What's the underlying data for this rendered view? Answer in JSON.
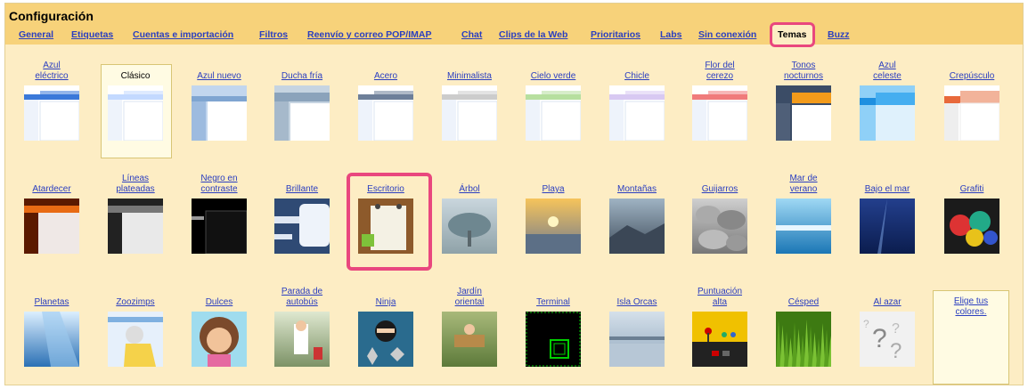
{
  "title": "Configuración",
  "tabs": [
    {
      "label": "General"
    },
    {
      "label": "Etiquetas"
    },
    {
      "label": "Cuentas e importación"
    },
    {
      "label": "Filtros"
    },
    {
      "label": "Reenvío y correo POP/IMAP"
    },
    {
      "label": "Chat"
    },
    {
      "label": "Clips de la Web"
    },
    {
      "label": "Prioritarios"
    },
    {
      "label": "Labs"
    },
    {
      "label": "Sin conexión"
    },
    {
      "label": "Temas",
      "active": true
    },
    {
      "label": "Buzz"
    }
  ],
  "themes": [
    {
      "row": 0,
      "col": 0,
      "label": "Azul\neléctrico",
      "icon": "azul-electrico-icon",
      "accent": "#3b79d9"
    },
    {
      "row": 0,
      "col": 1,
      "label": "Clásico",
      "icon": "clasico-icon",
      "accent": "#c3d9ff",
      "selected": true
    },
    {
      "row": 0,
      "col": 2,
      "label": "Azul nuevo",
      "icon": "azul-nuevo-icon",
      "accent": "#7fa5d1"
    },
    {
      "row": 0,
      "col": 3,
      "label": "Ducha fría",
      "icon": "ducha-fria-icon",
      "accent": "#8ba3bb"
    },
    {
      "row": 0,
      "col": 4,
      "label": "Acero",
      "icon": "acero-icon",
      "accent": "#6d7f99"
    },
    {
      "row": 0,
      "col": 5,
      "label": "Minimalista",
      "icon": "minimalista-icon",
      "accent": "#cccccc"
    },
    {
      "row": 0,
      "col": 6,
      "label": "Cielo verde",
      "icon": "cielo-verde-icon",
      "accent": "#b7df9f"
    },
    {
      "row": 0,
      "col": 7,
      "label": "Chicle",
      "icon": "chicle-icon",
      "accent": "#d8c9f2"
    },
    {
      "row": 0,
      "col": 8,
      "label": "Flor del\ncerezo",
      "icon": "flor-cerezo-icon",
      "accent": "#f07b7b"
    },
    {
      "row": 0,
      "col": 9,
      "label": "Tonos\nnocturnos",
      "icon": "tonos-nocturnos-icon",
      "accent": "#f39b1b"
    },
    {
      "row": 0,
      "col": 10,
      "label": "Azul\nceleste",
      "icon": "azul-celeste-icon",
      "accent": "#3aa3ec"
    },
    {
      "row": 0,
      "col": 11,
      "label": "Crepúsculo",
      "icon": "crepusculo-icon",
      "accent": "#e8693b"
    },
    {
      "row": 1,
      "col": 0,
      "label": "Atardecer",
      "icon": "atardecer-icon",
      "accent": "#e86b14"
    },
    {
      "row": 1,
      "col": 1,
      "label": "Líneas\nplateadas",
      "icon": "lineas-plateadas-icon",
      "accent": "#555555"
    },
    {
      "row": 1,
      "col": 2,
      "label": "Negro en\ncontraste",
      "icon": "negro-contraste-icon",
      "accent": "#222222"
    },
    {
      "row": 1,
      "col": 3,
      "label": "Brillante",
      "icon": "brillante-icon",
      "accent": "#4c6ea0"
    },
    {
      "row": 1,
      "col": 4,
      "label": "Escritorio",
      "icon": "escritorio-icon",
      "accent": "#8d5a2b",
      "highlighted": true
    },
    {
      "row": 1,
      "col": 5,
      "label": "Árbol",
      "icon": "arbol-icon",
      "accent": "#9bb0b7"
    },
    {
      "row": 1,
      "col": 6,
      "label": "Playa",
      "icon": "playa-icon",
      "accent": "#e49b31"
    },
    {
      "row": 1,
      "col": 7,
      "label": "Montañas",
      "icon": "montanas-icon",
      "accent": "#5d6e82"
    },
    {
      "row": 1,
      "col": 8,
      "label": "Guijarros",
      "icon": "guijarros-icon",
      "accent": "#8e8e8e"
    },
    {
      "row": 1,
      "col": 9,
      "label": "Mar de\nverano",
      "icon": "mar-verano-icon",
      "accent": "#2f9ad1"
    },
    {
      "row": 1,
      "col": 10,
      "label": "Bajo el mar",
      "icon": "bajo-mar-icon",
      "accent": "#1d3f8a"
    },
    {
      "row": 1,
      "col": 11,
      "label": "Grafiti",
      "icon": "grafiti-icon",
      "accent": "#c0392b"
    },
    {
      "row": 2,
      "col": 0,
      "label": "Planetas",
      "icon": "planetas-icon",
      "accent": "#3b8dd0"
    },
    {
      "row": 2,
      "col": 1,
      "label": "Zoozimps",
      "icon": "zoozimps-icon",
      "accent": "#f5d24a"
    },
    {
      "row": 2,
      "col": 2,
      "label": "Dulces",
      "icon": "dulces-icon",
      "accent": "#7b4a2b"
    },
    {
      "row": 2,
      "col": 3,
      "label": "Parada de\nautobús",
      "icon": "parada-autobus-icon",
      "accent": "#7c9266"
    },
    {
      "row": 2,
      "col": 4,
      "label": "Ninja",
      "icon": "ninja-icon",
      "accent": "#2a6b8e"
    },
    {
      "row": 2,
      "col": 5,
      "label": "Jardín\noriental",
      "icon": "jardin-oriental-icon",
      "accent": "#6f8a4a"
    },
    {
      "row": 2,
      "col": 6,
      "label": "Terminal",
      "icon": "terminal-icon",
      "accent": "#00d000"
    },
    {
      "row": 2,
      "col": 7,
      "label": "Isla Orcas",
      "icon": "isla-orcas-icon",
      "accent": "#8fa7bd"
    },
    {
      "row": 2,
      "col": 8,
      "label": "Puntuación\nalta",
      "icon": "puntuacion-alta-icon",
      "accent": "#f0c100"
    },
    {
      "row": 2,
      "col": 9,
      "label": "Césped",
      "icon": "cesped-icon",
      "accent": "#4f9a1c"
    },
    {
      "row": 2,
      "col": 10,
      "label": "Al azar",
      "icon": "al-azar-icon",
      "accent": "#999999"
    }
  ],
  "choose_colors": {
    "label": "Elige tus\ncolores."
  },
  "colors": {
    "header": "#f7d27a",
    "panel": "#fdedc4",
    "link": "#2a3ec0",
    "highlight": "#e9477e"
  }
}
